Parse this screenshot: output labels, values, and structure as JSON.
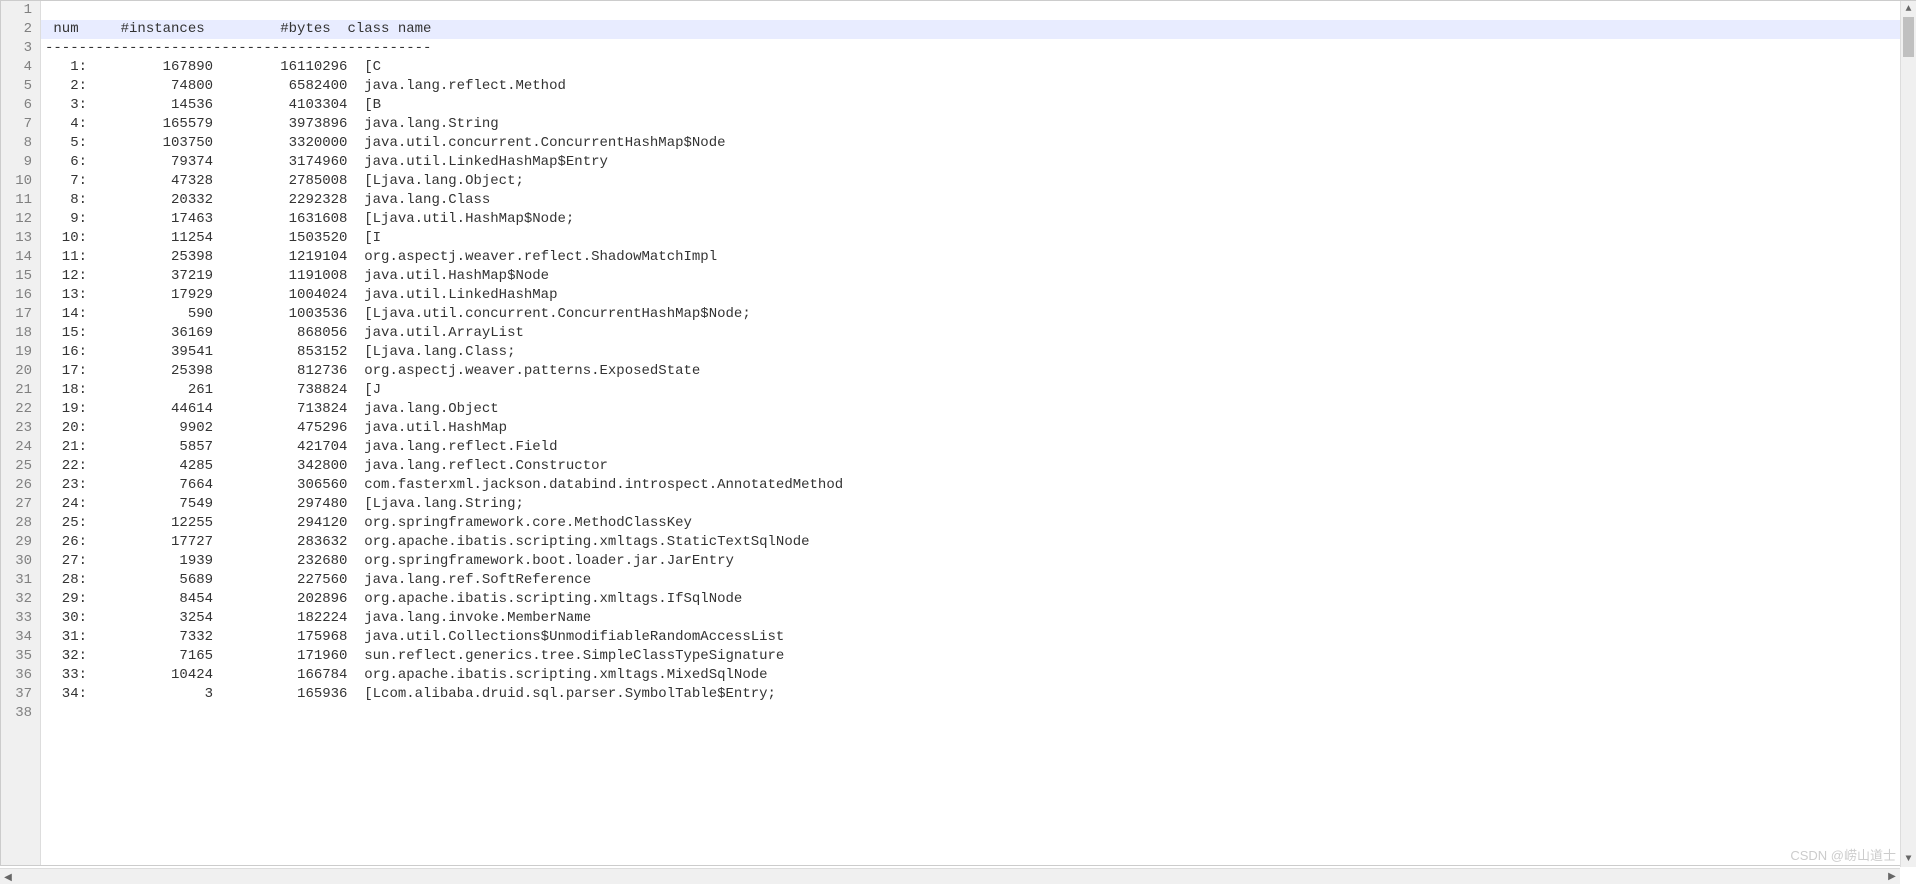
{
  "watermark": "CSDN @崂山道士",
  "header_line": " num     #instances         #bytes  class name",
  "separator_line": "----------------------------------------------",
  "rows": [
    {
      "num": "1",
      "instances": "167890",
      "bytes": "16110296",
      "class": "[C"
    },
    {
      "num": "2",
      "instances": "74800",
      "bytes": "6582400",
      "class": "java.lang.reflect.Method"
    },
    {
      "num": "3",
      "instances": "14536",
      "bytes": "4103304",
      "class": "[B"
    },
    {
      "num": "4",
      "instances": "165579",
      "bytes": "3973896",
      "class": "java.lang.String"
    },
    {
      "num": "5",
      "instances": "103750",
      "bytes": "3320000",
      "class": "java.util.concurrent.ConcurrentHashMap$Node"
    },
    {
      "num": "6",
      "instances": "79374",
      "bytes": "3174960",
      "class": "java.util.LinkedHashMap$Entry"
    },
    {
      "num": "7",
      "instances": "47328",
      "bytes": "2785008",
      "class": "[Ljava.lang.Object;"
    },
    {
      "num": "8",
      "instances": "20332",
      "bytes": "2292328",
      "class": "java.lang.Class"
    },
    {
      "num": "9",
      "instances": "17463",
      "bytes": "1631608",
      "class": "[Ljava.util.HashMap$Node;"
    },
    {
      "num": "10",
      "instances": "11254",
      "bytes": "1503520",
      "class": "[I"
    },
    {
      "num": "11",
      "instances": "25398",
      "bytes": "1219104",
      "class": "org.aspectj.weaver.reflect.ShadowMatchImpl"
    },
    {
      "num": "12",
      "instances": "37219",
      "bytes": "1191008",
      "class": "java.util.HashMap$Node"
    },
    {
      "num": "13",
      "instances": "17929",
      "bytes": "1004024",
      "class": "java.util.LinkedHashMap"
    },
    {
      "num": "14",
      "instances": "590",
      "bytes": "1003536",
      "class": "[Ljava.util.concurrent.ConcurrentHashMap$Node;"
    },
    {
      "num": "15",
      "instances": "36169",
      "bytes": "868056",
      "class": "java.util.ArrayList"
    },
    {
      "num": "16",
      "instances": "39541",
      "bytes": "853152",
      "class": "[Ljava.lang.Class;"
    },
    {
      "num": "17",
      "instances": "25398",
      "bytes": "812736",
      "class": "org.aspectj.weaver.patterns.ExposedState"
    },
    {
      "num": "18",
      "instances": "261",
      "bytes": "738824",
      "class": "[J"
    },
    {
      "num": "19",
      "instances": "44614",
      "bytes": "713824",
      "class": "java.lang.Object"
    },
    {
      "num": "20",
      "instances": "9902",
      "bytes": "475296",
      "class": "java.util.HashMap"
    },
    {
      "num": "21",
      "instances": "5857",
      "bytes": "421704",
      "class": "java.lang.reflect.Field"
    },
    {
      "num": "22",
      "instances": "4285",
      "bytes": "342800",
      "class": "java.lang.reflect.Constructor"
    },
    {
      "num": "23",
      "instances": "7664",
      "bytes": "306560",
      "class": "com.fasterxml.jackson.databind.introspect.AnnotatedMethod"
    },
    {
      "num": "24",
      "instances": "7549",
      "bytes": "297480",
      "class": "[Ljava.lang.String;"
    },
    {
      "num": "25",
      "instances": "12255",
      "bytes": "294120",
      "class": "org.springframework.core.MethodClassKey"
    },
    {
      "num": "26",
      "instances": "17727",
      "bytes": "283632",
      "class": "org.apache.ibatis.scripting.xmltags.StaticTextSqlNode"
    },
    {
      "num": "27",
      "instances": "1939",
      "bytes": "232680",
      "class": "org.springframework.boot.loader.jar.JarEntry"
    },
    {
      "num": "28",
      "instances": "5689",
      "bytes": "227560",
      "class": "java.lang.ref.SoftReference"
    },
    {
      "num": "29",
      "instances": "8454",
      "bytes": "202896",
      "class": "org.apache.ibatis.scripting.xmltags.IfSqlNode"
    },
    {
      "num": "30",
      "instances": "3254",
      "bytes": "182224",
      "class": "java.lang.invoke.MemberName"
    },
    {
      "num": "31",
      "instances": "7332",
      "bytes": "175968",
      "class": "java.util.Collections$UnmodifiableRandomAccessList"
    },
    {
      "num": "32",
      "instances": "7165",
      "bytes": "171960",
      "class": "sun.reflect.generics.tree.SimpleClassTypeSignature"
    },
    {
      "num": "33",
      "instances": "10424",
      "bytes": "166784",
      "class": "org.apache.ibatis.scripting.xmltags.MixedSqlNode"
    },
    {
      "num": "34",
      "instances": "3",
      "bytes": "165936",
      "class": "[Lcom.alibaba.druid.sql.parser.SymbolTable$Entry;"
    }
  ]
}
